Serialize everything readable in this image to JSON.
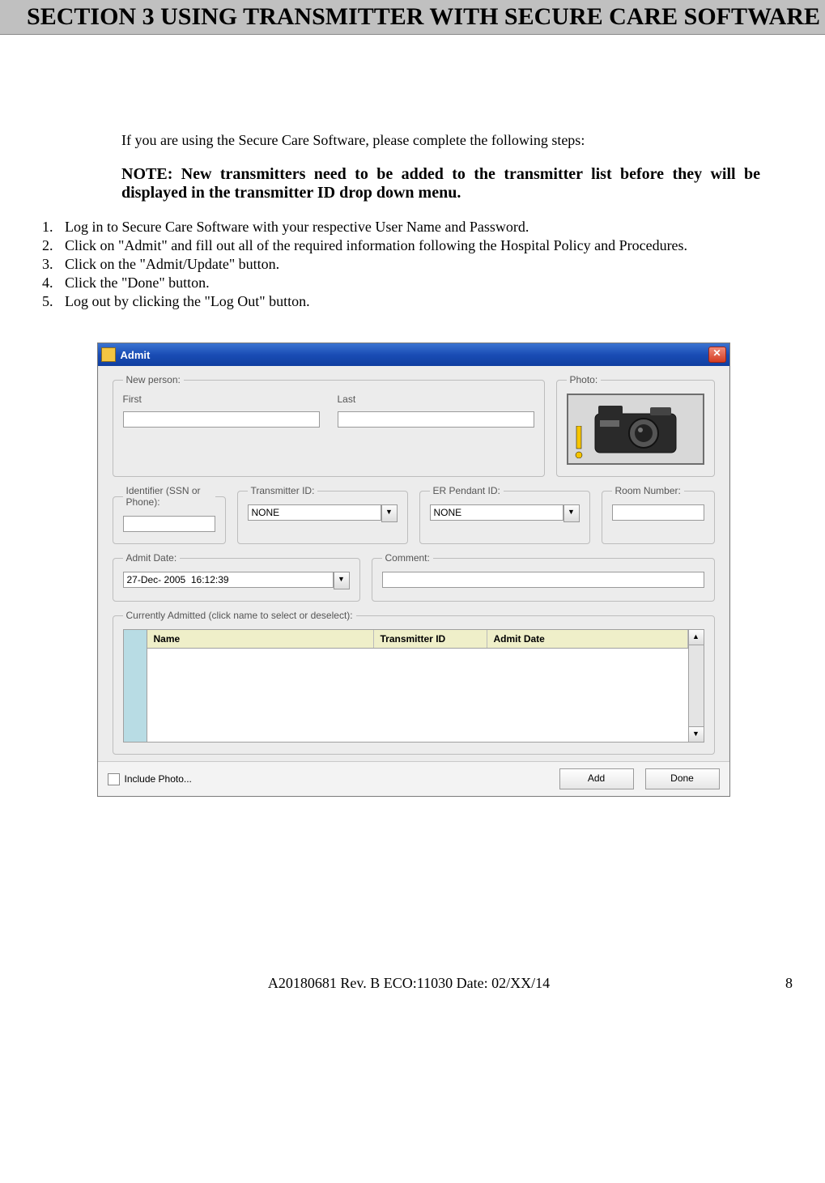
{
  "section": {
    "title": "SECTION 3   USING TRANSMITTER WITH SECURE CARE SOFTWARE"
  },
  "intro": "If you are using the Secure Care Software, please complete the following steps:",
  "note": {
    "label": "NOTE",
    "text": "New transmitters need to be added to the transmitter list before they will be displayed in the transmitter ID drop down menu."
  },
  "steps": [
    "Log in to Secure Care Software with your respective User Name and Password.",
    "Click on \"Admit\" and fill out all of the required information following the Hospital Policy and Procedures.",
    "Click on the \"Admit/Update\" button.",
    "Click the \"Done\" button.",
    "Log out by clicking the \"Log Out\" button."
  ],
  "dialog": {
    "title": "Admit",
    "close_glyph": "✕",
    "new_person": {
      "legend": "New person:",
      "first_label": "First",
      "last_label": "Last",
      "first_value": "",
      "last_value": ""
    },
    "photo": {
      "legend": "Photo:"
    },
    "identifier": {
      "legend": "Identifier (SSN or Phone):",
      "value": ""
    },
    "transmitter": {
      "legend": "Transmitter ID:",
      "value": "NONE"
    },
    "er_pendant": {
      "legend": "ER Pendant ID:",
      "value": "NONE"
    },
    "room": {
      "legend": "Room Number:",
      "value": ""
    },
    "admit_date": {
      "legend": "Admit Date:",
      "value": "27-Dec- 2005  16:12:39"
    },
    "comment": {
      "legend": "Comment:",
      "value": ""
    },
    "currently": {
      "legend": "Currently Admitted (click name to select or deselect):",
      "columns": {
        "name": "Name",
        "tx": "Transmitter ID",
        "admit": "Admit Date"
      }
    },
    "footer": {
      "include_photo": "Include Photo...",
      "add": "Add",
      "done": "Done"
    },
    "dropdown_glyph": "▼",
    "scroll_up_glyph": "▲",
    "scroll_down_glyph": "▼"
  },
  "footer": {
    "revision": "A20180681 Rev. B  ECO:11030 Date: 02/XX/14",
    "page": "8"
  }
}
